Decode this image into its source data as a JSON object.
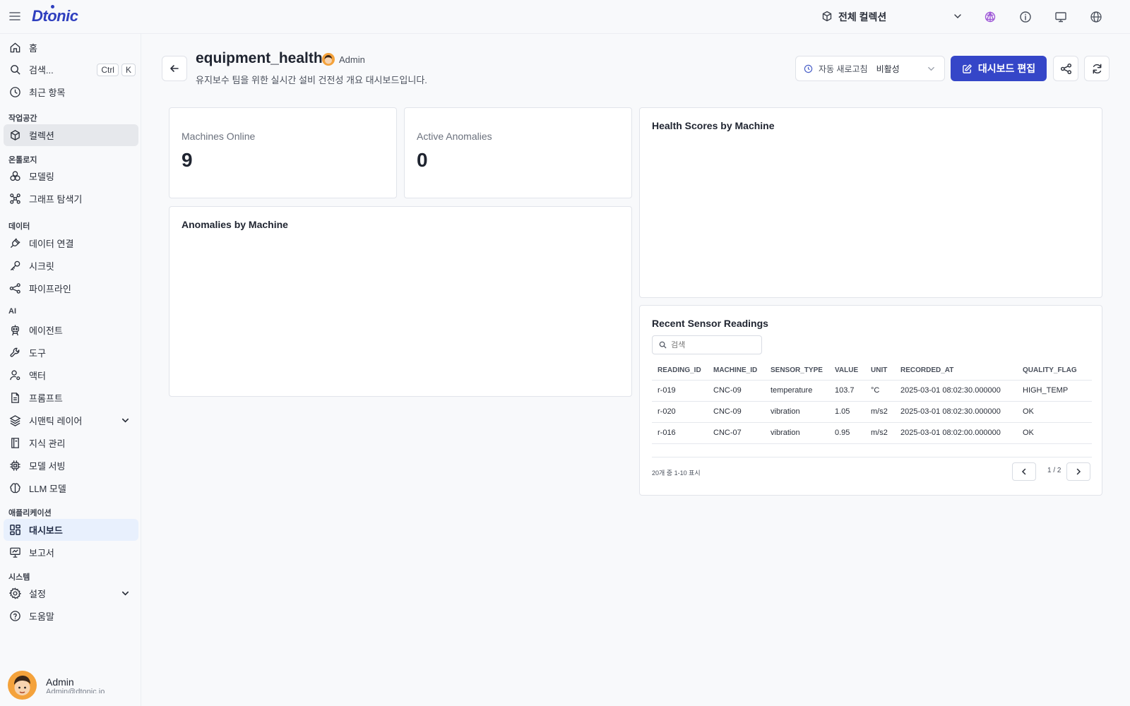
{
  "app": {
    "logo": "Dtonic"
  },
  "topbar": {
    "collection_label": "전체 컬렉션",
    "icons": [
      "menu-icon",
      "cube-icon",
      "chevron-down-icon",
      "network-icon",
      "info-icon",
      "monitor-icon",
      "globe-icon"
    ]
  },
  "sidebar": {
    "home": "홈",
    "search": "검색...",
    "search_kbd": [
      "Ctrl",
      "K"
    ],
    "recent": "최근 항목",
    "sections": {
      "workspace": "작업공간",
      "ontology": "온톨로지",
      "data": "데이터",
      "ai": "AI",
      "applications": "애플리케이션",
      "system": "시스템"
    },
    "collections": "컬렉션",
    "modeling": "모델링",
    "graph_explorer": "그래프 탐색기",
    "data_connection": "데이터 연결",
    "secrets": "시크릿",
    "pipeline": "파이프라인",
    "agents": "에이전트",
    "tools": "도구",
    "actors": "액터",
    "prompts": "프롬프트",
    "semantic_layer": "시맨틱 레이어",
    "knowledge": "지식 관리",
    "model_serving": "모델 서빙",
    "llm_models": "LLM 모델",
    "dashboards": "대시보드",
    "reports": "보고서",
    "settings": "설정",
    "help": "도움말",
    "user": {
      "name": "Admin",
      "email": "Admin@dtonic.io"
    }
  },
  "header": {
    "title": "equipment_health",
    "owner": "Admin",
    "description": "유지보수 팀을 위한 실시간 설비 건전성 개요 대시보드입니다.",
    "auto_refresh_label": "자동 새로고침",
    "auto_refresh_value": "비활성",
    "edit_label": "대시보드 편집"
  },
  "widgets": {
    "machines_online": {
      "label": "Machines Online",
      "value": "9"
    },
    "active_anomalies": {
      "label": "Active Anomalies",
      "value": "0"
    },
    "health_scores": {
      "title": "Health Scores by Machine"
    },
    "anomalies_by_machine": {
      "title": "Anomalies by Machine"
    },
    "recent_readings": {
      "title": "Recent Sensor Readings",
      "search_placeholder": "검색",
      "columns": [
        "READING_ID",
        "MACHINE_ID",
        "SENSOR_TYPE",
        "VALUE",
        "UNIT",
        "RECORDED_AT",
        "QUALITY_FLAG"
      ],
      "rows": [
        [
          "r-019",
          "CNC-09",
          "temperature",
          "103.7",
          "°C",
          "2025-03-01 08:02:30.000000",
          "HIGH_TEMP"
        ],
        [
          "r-020",
          "CNC-09",
          "vibration",
          "1.05",
          "m/s2",
          "2025-03-01 08:02:30.000000",
          "OK"
        ],
        [
          "r-016",
          "CNC-07",
          "vibration",
          "0.95",
          "m/s2",
          "2025-03-01 08:02:00.000000",
          "OK"
        ]
      ],
      "footer": "20개 중 1-10 표시",
      "page": "1 / 2"
    }
  },
  "colors": {
    "accent": "#3546c8",
    "active_nav": "#e8f0fd",
    "avatar": "#f4a23b"
  }
}
